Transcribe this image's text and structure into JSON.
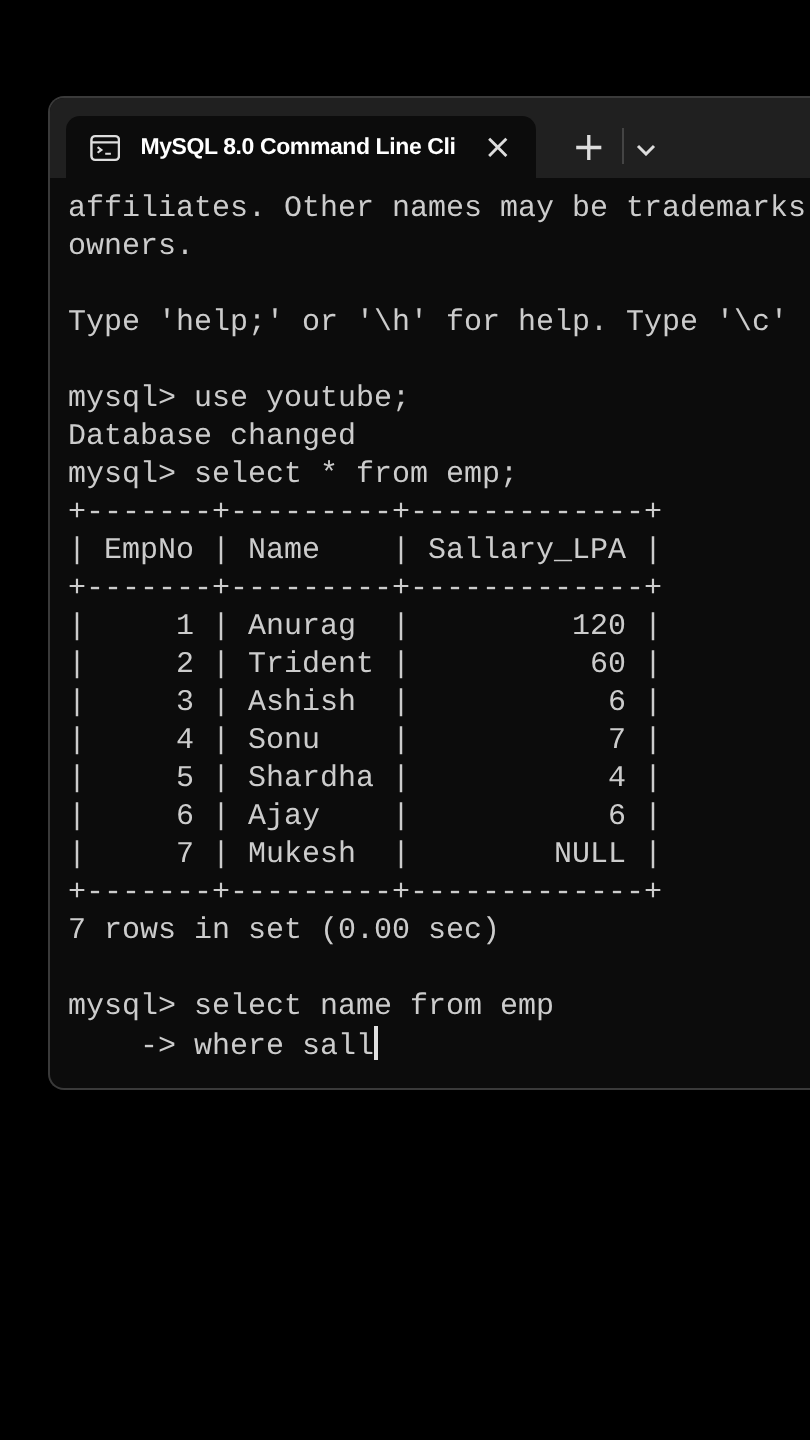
{
  "window": {
    "tab": {
      "title": "MySQL 8.0 Command Line Cli",
      "selected": true,
      "close": "×"
    },
    "new_tab": "+"
  },
  "terminal": {
    "lines": [
      {
        "kind": "output",
        "text": "affiliates. Other names may be trademarks"
      },
      {
        "kind": "output",
        "text": "owners."
      },
      {
        "kind": "blank"
      },
      {
        "kind": "output",
        "text": "Type 'help;' or '\\h' for help. Type '\\c'"
      },
      {
        "kind": "blank"
      },
      {
        "kind": "output",
        "text": "mysql> use youtube;"
      },
      {
        "kind": "output",
        "text": "Database changed"
      },
      {
        "kind": "output",
        "text": "mysql> select * from emp;"
      },
      {
        "kind": "output",
        "text": "+-------+---------+-------------+"
      },
      {
        "kind": "output",
        "text": "| EmpNo | Name    | Sallary_LPA |"
      },
      {
        "kind": "output",
        "text": "+-------+---------+-------------+"
      },
      {
        "kind": "output",
        "text": "|     1 | Anurag  |         120 |"
      },
      {
        "kind": "output",
        "text": "|     2 | Trident |          60 |"
      },
      {
        "kind": "output",
        "text": "|     3 | Ashish  |           6 |"
      },
      {
        "kind": "output",
        "text": "|     4 | Sonu    |           7 |"
      },
      {
        "kind": "output",
        "text": "|     5 | Shardha |           4 |"
      },
      {
        "kind": "output",
        "text": "|     6 | Ajay    |           6 |"
      },
      {
        "kind": "output",
        "text": "|     7 | Mukesh  |        NULL |"
      },
      {
        "kind": "output",
        "text": "+-------+---------+-------------+"
      },
      {
        "kind": "output",
        "text": "7 rows in set (0.00 sec)"
      },
      {
        "kind": "blank"
      },
      {
        "kind": "output",
        "text": "mysql> select name from emp"
      },
      {
        "kind": "input",
        "text": "    -> where sall"
      }
    ]
  }
}
